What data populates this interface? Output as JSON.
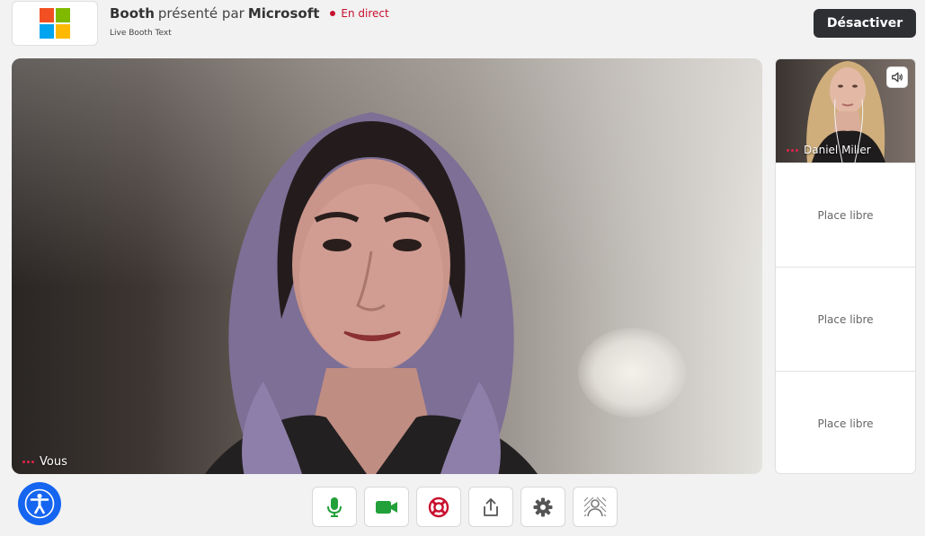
{
  "header": {
    "booth_label": "Booth",
    "presented_by": "présenté par",
    "sponsor": "Microsoft",
    "live_label": "En direct",
    "subtitle": "Live Booth Text",
    "deactivate_label": "Désactiver",
    "logo_colors": [
      "#f25022",
      "#7fba00",
      "#00a4ef",
      "#ffb900"
    ]
  },
  "main_video": {
    "participant_label": "Vous"
  },
  "side_panel": {
    "active_participant": {
      "name": "Daniel Miller",
      "icon": "speaker-icon"
    },
    "slots": [
      {
        "label": "Place libre"
      },
      {
        "label": "Place libre"
      },
      {
        "label": "Place libre"
      }
    ]
  },
  "toolbar": {
    "buttons": [
      {
        "icon": "microphone-icon",
        "color": "#22a03a"
      },
      {
        "icon": "camera-icon",
        "color": "#22a03a"
      },
      {
        "icon": "lifebuoy-icon",
        "color": "#c8102e"
      },
      {
        "icon": "share-icon",
        "color": "#555555"
      },
      {
        "icon": "gear-icon",
        "color": "#555555"
      },
      {
        "icon": "background-blur-icon",
        "color": "#777777"
      }
    ]
  },
  "accessibility": {
    "icon": "accessibility-icon",
    "color": "#1565f0"
  }
}
